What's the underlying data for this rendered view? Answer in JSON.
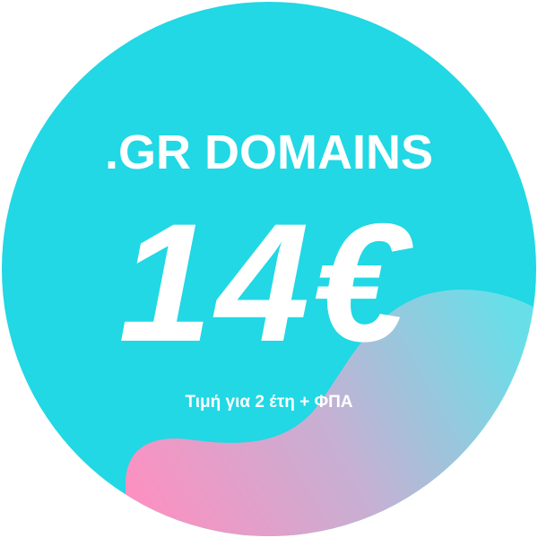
{
  "badge": {
    "title": ".GR DOMAINS",
    "price": "14€",
    "note": "Τιμή για 2 έτη + ΦΠΑ"
  },
  "colors": {
    "circle": "#21d8e4",
    "wave_start": "#fe8fc0",
    "wave_end": "#68dfe8",
    "text": "#ffffff"
  }
}
